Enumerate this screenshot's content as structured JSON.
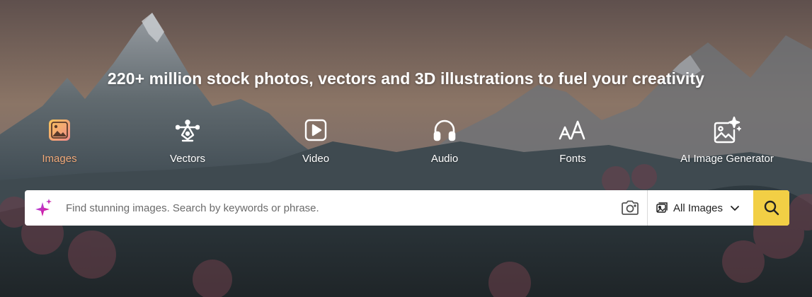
{
  "headline": "220+ million stock photos, vectors and 3D illustrations to fuel your creativity",
  "colors": {
    "active_category": "#f0a878",
    "search_button": "#f2cf45",
    "spark_pink": "#e6007e",
    "spark_violet": "#a45cf5"
  },
  "categories": [
    {
      "label": "Images",
      "icon": "image-icon",
      "active": true
    },
    {
      "label": "Vectors",
      "icon": "pen-tool-icon",
      "active": false
    },
    {
      "label": "Video",
      "icon": "play-video-icon",
      "active": false
    },
    {
      "label": "Audio",
      "icon": "headphones-icon",
      "active": false
    },
    {
      "label": "Fonts",
      "icon": "font-icon",
      "active": false
    },
    {
      "label": "AI Image Generator",
      "icon": "ai-image-icon",
      "active": false
    }
  ],
  "search": {
    "placeholder": "Find stunning images. Search by keywords or phrase.",
    "value": "",
    "type_label": "All Images"
  },
  "icons": {
    "sparkle": "sparkle-icon",
    "camera": "camera-icon",
    "type": "image-small-icon",
    "dropdown": "chevron-down-icon",
    "search": "search-icon"
  }
}
